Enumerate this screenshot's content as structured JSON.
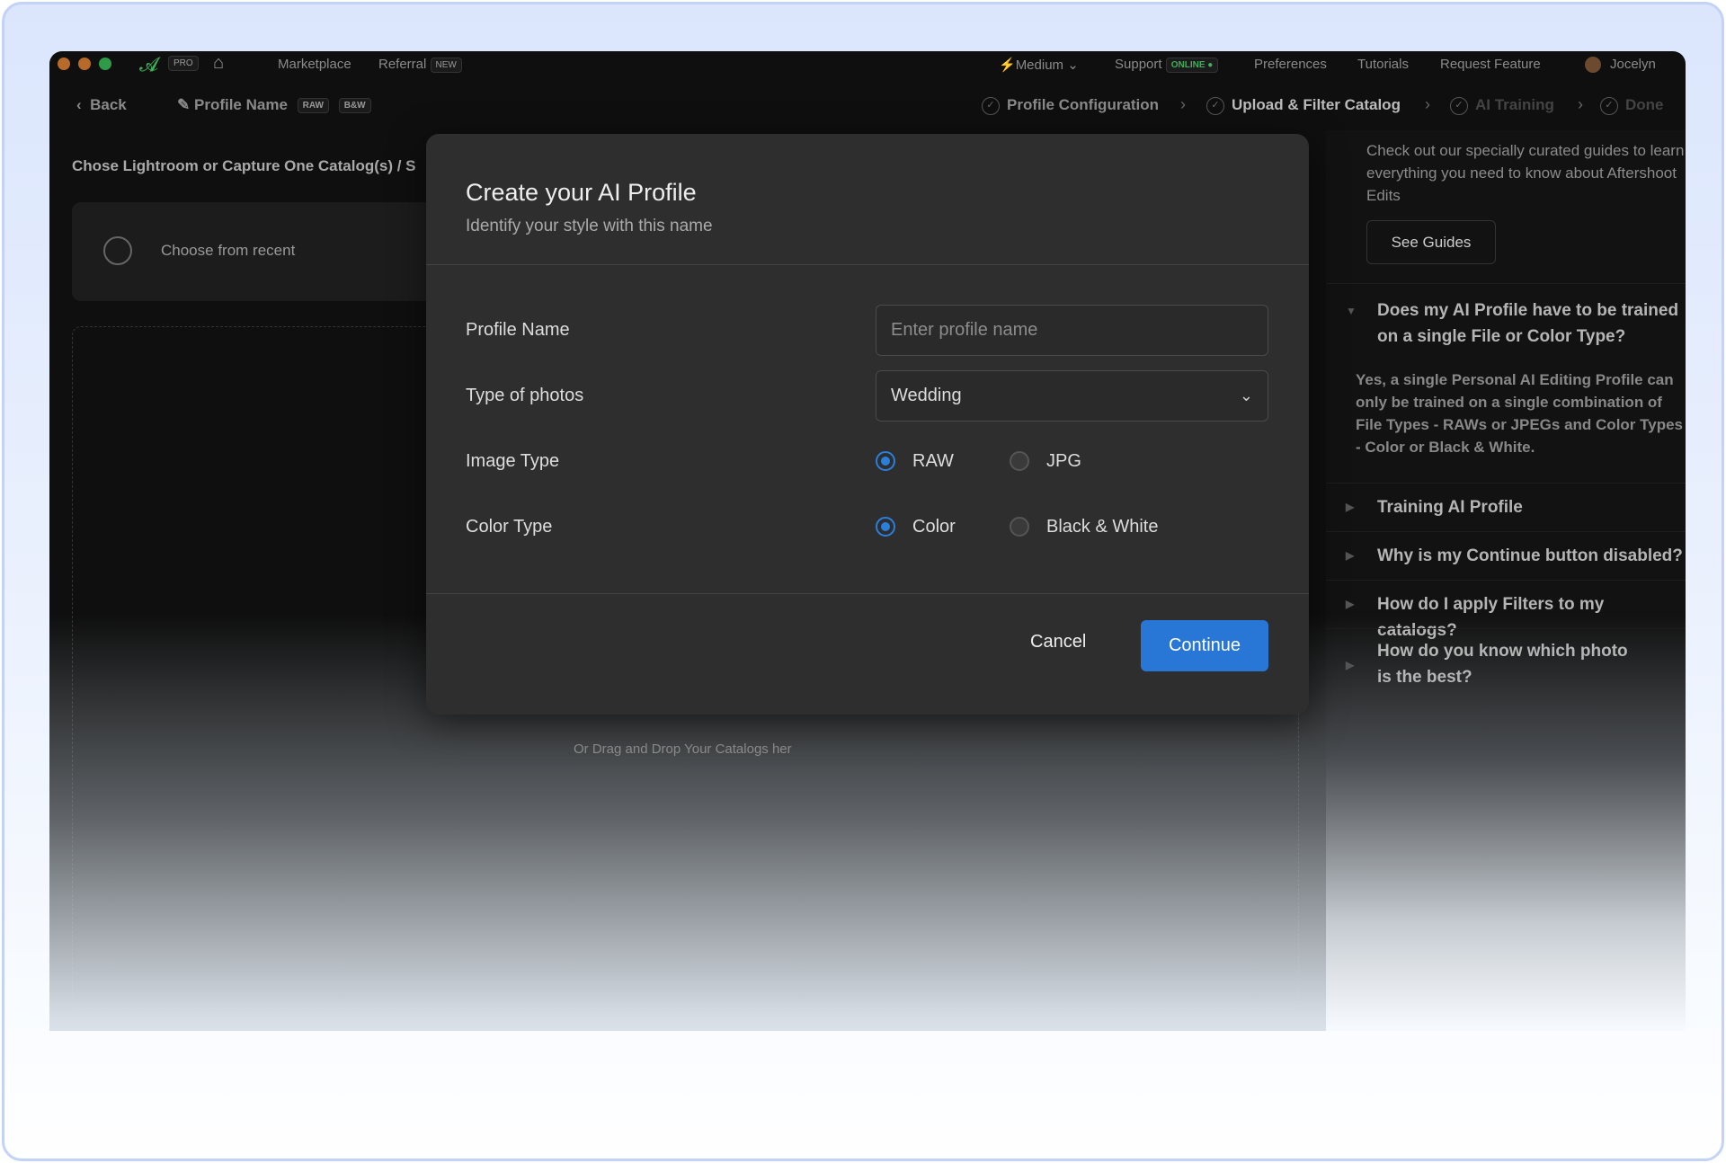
{
  "titlebar": {
    "pro_badge": "PRO",
    "marketplace": "Marketplace",
    "referral": "Referral",
    "referral_badge": "NEW",
    "speed": "Medium",
    "support": "Support",
    "support_status": "ONLINE",
    "preferences": "Preferences",
    "tutorials": "Tutorials",
    "request_feature": "Request Feature",
    "user": "Jocelyn"
  },
  "navbar": {
    "back": "Back",
    "profile_name": "Profile Name",
    "badges": [
      "RAW",
      "B&W"
    ],
    "steps": [
      "Profile Configuration",
      "Upload & Filter Catalog",
      "AI Training",
      "Done"
    ]
  },
  "left": {
    "heading": "Chose Lightroom or Capture One Catalog(s) / S",
    "recent": "Choose from recent",
    "drag": "Or Drag and Drop Your Catalogs her"
  },
  "right": {
    "intro": "Check out our specially curated guides to learn everything you need to know about Aftershoot Edits",
    "see_guides": "See Guides",
    "faq": [
      {
        "q": "Does my AI Profile have to be trained on a single File or Color Type?",
        "a": "Yes, a single Personal AI Editing Profile can only be trained on a single combination of File Types - RAWs or JPEGs and Color Types - Color or Black & White."
      },
      {
        "q": "Training AI Profile"
      },
      {
        "q": "Why is my Continue button disabled?"
      },
      {
        "q": "How do I apply Filters to my catalogs?"
      },
      {
        "q": "How do you know which photo is the best?"
      }
    ]
  },
  "modal": {
    "title": "Create your AI Profile",
    "subtitle": "Identify your style with this name",
    "profile_name_label": "Profile Name",
    "profile_name_placeholder": "Enter profile name",
    "profile_name_value": "",
    "type_label": "Type of photos",
    "type_value": "Wedding",
    "image_type_label": "Image Type",
    "image_type_options": [
      "RAW",
      "JPG"
    ],
    "image_type_selected": "RAW",
    "color_type_label": "Color Type",
    "color_type_options": [
      "Color",
      "Black & White"
    ],
    "color_type_selected": "Color",
    "cancel": "Cancel",
    "continue": "Continue"
  },
  "colors": {
    "accent": "#2877d6",
    "online": "#3fae5a"
  }
}
